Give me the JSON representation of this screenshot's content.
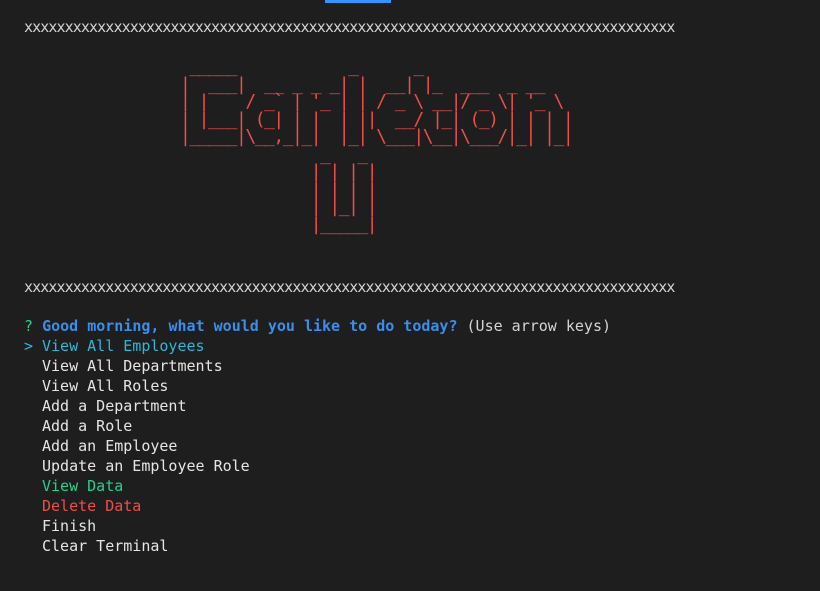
{
  "separator": "xxxxxxxxxxxxxxxxxxxxxxxxxxxxxxxxxxxxxxxxxxxxxxxxxxxxxxxxxxxxxxxxxxxxxxxxxxxxxxxx",
  "banner_text": "Carleton U",
  "banner_ascii": " _____            _      _\n|  ___|  __ _ _ _| |  __| |_  ___  _ __\n| |    / _` | '_ | | / _ \\ __|/ _ \\| '_ \\\n| |___| (_| | |  | ||  __/ |_| (_) | | | |\n|_____|\\__,_|_|  |_| \\___|\\__|\\___/|_| |_|\n               _   _\n              | | | |\n              | | | |\n              | |_| |\n              |_____|",
  "prompt": {
    "marker": "?",
    "question": "Good morning, what would you like to do today?",
    "hint": "(Use arrow keys)"
  },
  "menu": {
    "cursor": ">",
    "items": [
      {
        "label": "View All Employees"
      },
      {
        "label": "View All Departments"
      },
      {
        "label": "View All Roles"
      },
      {
        "label": "Add a Department"
      },
      {
        "label": "Add a Role"
      },
      {
        "label": "Add an Employee"
      },
      {
        "label": "Update an Employee Role"
      },
      {
        "label": "View Data"
      },
      {
        "label": "Delete Data"
      },
      {
        "label": "Finish"
      },
      {
        "label": "Clear Terminal"
      }
    ],
    "selected_index": 0
  },
  "colors": {
    "background": "#1e1e1e",
    "banner": "#f14c4c",
    "question": "#3b8eea",
    "selected": "#29b8db",
    "view_data": "#23d18b",
    "delete_data": "#f14c4c"
  }
}
